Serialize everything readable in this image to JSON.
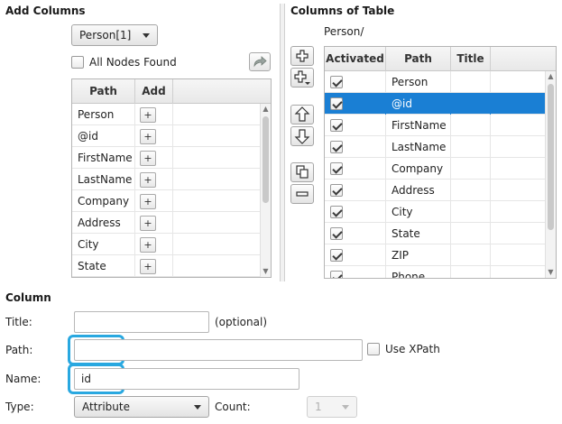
{
  "add_columns": {
    "title": "Add Columns",
    "node_select": "Person[1]",
    "all_nodes_label": "All Nodes Found",
    "table": {
      "headers": [
        "Path",
        "Add"
      ],
      "add_symbol": "+",
      "rows": [
        "Person",
        "@id",
        "FirstName",
        "LastName",
        "Company",
        "Address",
        "City",
        "State"
      ]
    }
  },
  "columns_of_table": {
    "title": "Columns of Table",
    "path": "Person/",
    "table": {
      "headers": [
        "Activated",
        "Path",
        "Title"
      ],
      "rows": [
        {
          "path": "Person",
          "activated": true,
          "selected": false
        },
        {
          "path": "@id",
          "activated": true,
          "selected": true
        },
        {
          "path": "FirstName",
          "activated": true,
          "selected": false
        },
        {
          "path": "LastName",
          "activated": true,
          "selected": false
        },
        {
          "path": "Company",
          "activated": true,
          "selected": false
        },
        {
          "path": "Address",
          "activated": true,
          "selected": false
        },
        {
          "path": "City",
          "activated": true,
          "selected": false
        },
        {
          "path": "State",
          "activated": true,
          "selected": false
        },
        {
          "path": "ZIP",
          "activated": true,
          "selected": false
        },
        {
          "path": "Phone",
          "activated": true,
          "selected": false
        }
      ]
    }
  },
  "column": {
    "title": "Column",
    "title_label": "Title:",
    "title_value": "",
    "optional_label": "(optional)",
    "path_label": "Path:",
    "path_value": "",
    "use_xpath_label": "Use XPath",
    "name_label": "Name:",
    "name_value": "id",
    "type_label": "Type:",
    "type_value": "Attribute",
    "count_label": "Count:",
    "count_value": "1"
  },
  "colors": {
    "selection": "#1a7fd4",
    "focus_ring": "#29a8e0"
  }
}
